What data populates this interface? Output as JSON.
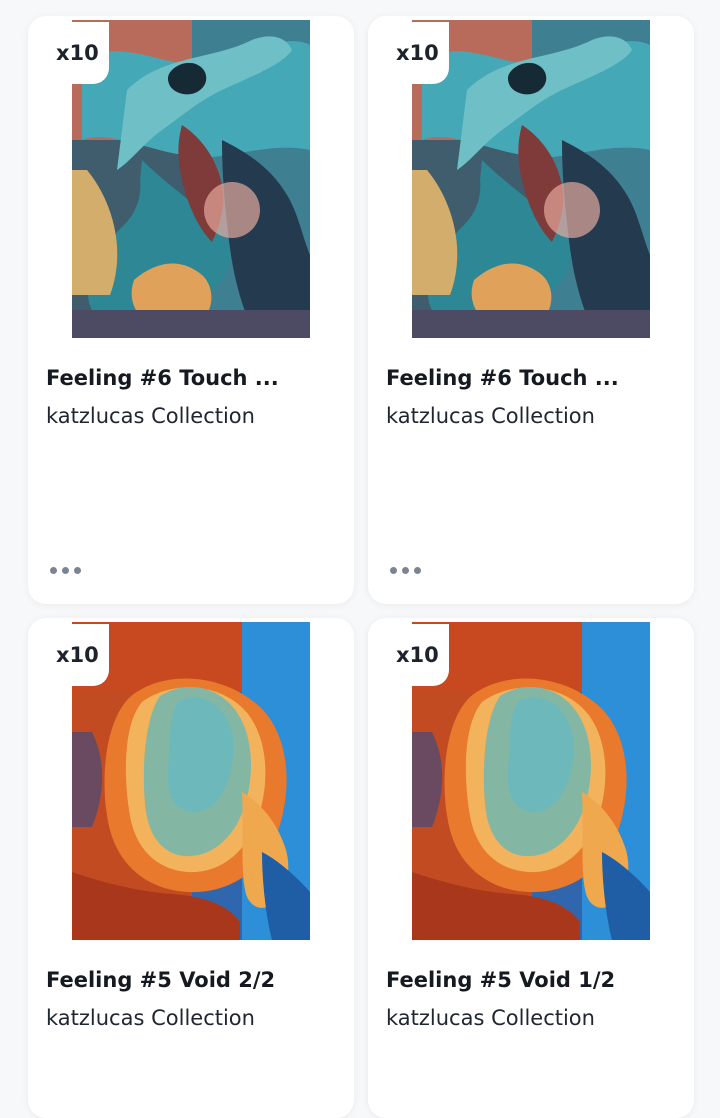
{
  "cards": [
    {
      "badge": "x10",
      "title": "Feeling #6 Touch ...",
      "collection": "katzlucas Collection",
      "art": "touch"
    },
    {
      "badge": "x10",
      "title": "Feeling #6 Touch ...",
      "collection": "katzlucas Collection",
      "art": "touch"
    },
    {
      "badge": "x10",
      "title": "Feeling #5 Void 2/2",
      "collection": "katzlucas Collection",
      "art": "void"
    },
    {
      "badge": "x10",
      "title": "Feeling #5 Void 1/2",
      "collection": "katzlucas Collection",
      "art": "void"
    }
  ],
  "more_icon": "more-dots-icon"
}
